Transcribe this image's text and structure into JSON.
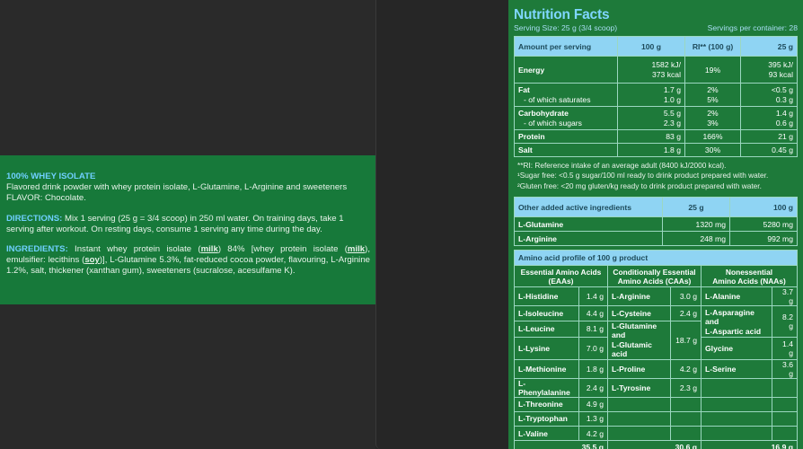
{
  "product": {
    "title_prefix": "100%",
    "title_rest": " WHEY ISOLATE",
    "line1": "Flavored drink powder with whey protein isolate, L-Glutamine, L-Arginine and sweeteners",
    "flavor": "FLAVOR: Chocolate.",
    "directions_label": "DIRECTIONS:",
    "directions_text": " Mix 1 serving (25 g = 3/4 scoop) in 250 ml water. On training days, take 1 serving after workout. On resting days, consume 1 serving any time during the day.",
    "ingredients_label": "INGREDIENTS:",
    "ing_p1": " Instant whey protein isolate (",
    "ing_milk1": "milk",
    "ing_p2": ") 84% [whey protein isolate (",
    "ing_milk2": "milk",
    "ing_p3": "), emulsifier: lecithins (",
    "ing_soy": "soy",
    "ing_p4": ")], L-Glutamine 5.3%, fat-reduced cocoa powder, flavouring, L-Arginine 1.2%, salt, thickener (xanthan gum), sweeteners (sucralose, acesulfame K)."
  },
  "nutrition": {
    "title": "Nutrition Facts",
    "serving_size": "Serving Size: 25 g (3/4 scoop)",
    "servings_per_container": "Servings per container: 28",
    "headers": [
      "Amount per serving",
      "100 g",
      "RI** (100 g)",
      "25 g"
    ],
    "rows": [
      {
        "name": "Energy",
        "sub": "",
        "g100": "1582 kJ/\n373 kcal",
        "ri": "19%",
        "g25": "395 kJ/\n93 kcal"
      },
      {
        "name": "Fat",
        "sub": "- of which saturates",
        "g100": "1.7 g",
        "g100b": "1.0 g",
        "ri": "2%",
        "rib": "5%",
        "g25": "<0.5 g",
        "g25b": "0.3 g"
      },
      {
        "name": "Carbohydrate",
        "sub": "- of which sugars",
        "g100": "5.5 g",
        "g100b": "2.3 g",
        "ri": "2%",
        "rib": "3%",
        "g25": "1.4 g",
        "g25b": "0.6 g"
      },
      {
        "name": "Protein",
        "g100": "83 g",
        "ri": "166%",
        "g25": "21 g"
      },
      {
        "name": "Salt",
        "g100": "1.8 g",
        "ri": "30%",
        "g25": "0.45 g"
      }
    ],
    "notes": [
      "**RI: Reference intake of an average adult (8400 kJ/2000 kcal).",
      "¹Sugar free: <0.5 g sugar/100 ml ready to drink product prepared with water.",
      "²Gluten free: <20 mg gluten/kg ready to drink product prepared with water."
    ],
    "active_headers": [
      "Other added active ingredients",
      "25 g",
      "100 g"
    ],
    "active_rows": [
      {
        "name": "L-Glutamine",
        "g25": "1320 mg",
        "g100": "5280 mg"
      },
      {
        "name": "L-Arginine",
        "g25": "248 mg",
        "g100": "992 mg"
      }
    ],
    "aa_title": "Amino acid profile of 100 g product",
    "aa_headers": [
      "Essential Amino Acids\n(EAAs)",
      "Conditionally Essential\nAmino Acids (CAAs)",
      "Nonessential\nAmino Acids (NAAs)"
    ],
    "eaa": [
      [
        "L-Histidine",
        "1.4 g"
      ],
      [
        "L-Isoleucine",
        "4.4 g"
      ],
      [
        "L-Leucine",
        "8.1 g"
      ],
      [
        "L-Lysine",
        "7.0 g"
      ],
      [
        "L-Methionine",
        "1.8 g"
      ],
      [
        "L-Phenylalanine",
        "2.4 g"
      ],
      [
        "L-Threonine",
        "4.9 g"
      ],
      [
        "L-Tryptophan",
        "1.3 g"
      ],
      [
        "L-Valine",
        "4.2 g"
      ]
    ],
    "caa": [
      [
        "L-Arginine",
        "3.0 g"
      ],
      [
        "L-Cysteine",
        "2.4 g"
      ],
      [
        "L-Glutamine and\nL-Glutamic acid",
        "18.7 g"
      ],
      [
        "L-Proline",
        "4.2 g"
      ],
      [
        "L-Tyrosine",
        "2.3 g"
      ]
    ],
    "naa": [
      [
        "L-Alanine",
        "3.7 g"
      ],
      [
        "L-Asparagine and\nL-Aspartic acid",
        "8.2 g"
      ],
      [
        "Glycine",
        "1.4 g"
      ],
      [
        "L-Serine",
        "3.6 g"
      ]
    ],
    "totals": [
      "35.5 g",
      "30.6 g",
      "16.9 g"
    ]
  }
}
